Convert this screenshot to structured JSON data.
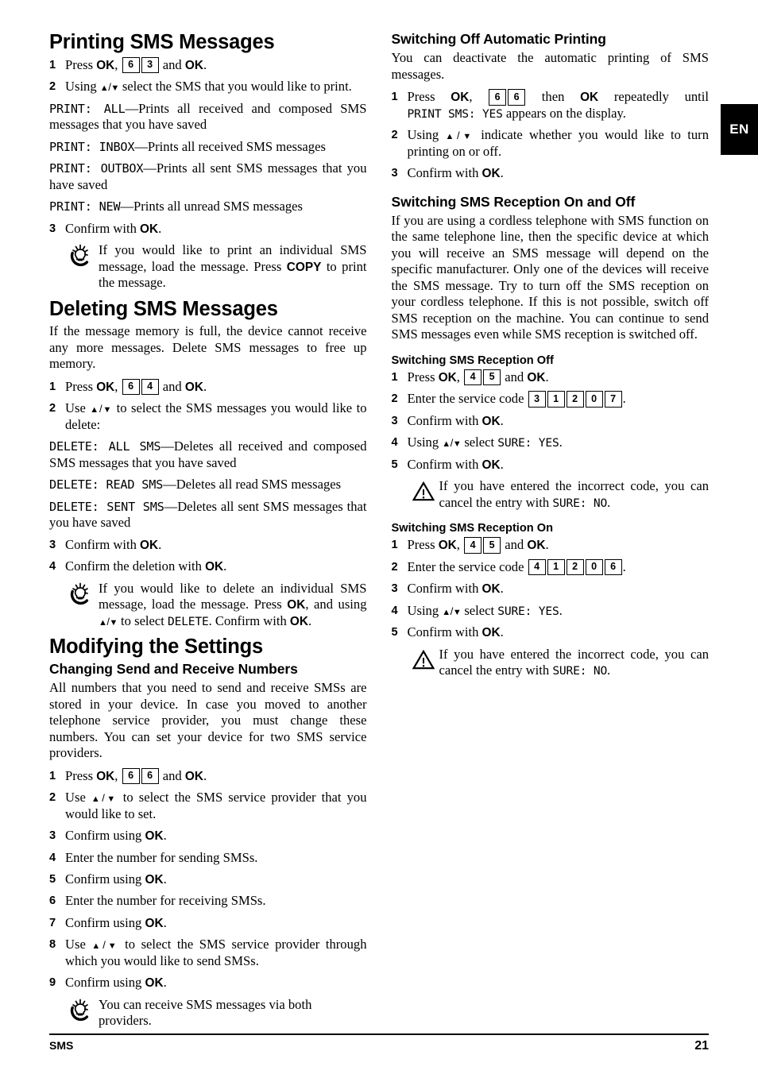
{
  "page": {
    "language_tab": "EN",
    "footer_left": "SMS",
    "footer_page": "21"
  },
  "left_column": {
    "section1": {
      "heading": "Printing SMS Messages",
      "steps": [
        {
          "num": "1",
          "pre": "Press ",
          "key_ok_1": "OK",
          "mid": ", ",
          "keys": [
            "6",
            "3"
          ],
          "post_pre": " and ",
          "key_ok_2": "OK",
          "post": "."
        },
        {
          "num": "2",
          "text_a": "Using ",
          "text_b": " select the SMS that you would like to print."
        }
      ],
      "options": [
        {
          "lcd": "PRINT: ALL",
          "desc": "—Prints all received and composed SMS messages that you have saved"
        },
        {
          "lcd": "PRINT: INBOX",
          "desc": "—Prints all received SMS messages"
        },
        {
          "lcd": "PRINT: OUTBOX",
          "desc": "—Prints all sent SMS messages that you have saved"
        },
        {
          "lcd": "PRINT: NEW",
          "desc": "—Prints all unread SMS messages"
        }
      ],
      "step3": {
        "num": "3",
        "pre": "Confirm with ",
        "key_ok": "OK",
        "post": "."
      },
      "tip": {
        "icon": "tip-hand-icon",
        "text_a": "If you would like to print an individual SMS message, load the message. Press ",
        "key": "COPY",
        "text_b": " to print the message."
      }
    },
    "section2": {
      "heading": "Deleting SMS Messages",
      "intro": "If the message memory is full, the device cannot receive any more messages. Delete SMS messages to free up memory.",
      "steps": [
        {
          "num": "1",
          "pre": "Press ",
          "key_ok_1": "OK",
          "mid": ", ",
          "keys": [
            "6",
            "4"
          ],
          "post_pre": " and ",
          "key_ok_2": "OK",
          "post": "."
        },
        {
          "num": "2",
          "text_a": "Use ",
          "text_b": " to select the SMS messages you would like to delete:"
        }
      ],
      "options": [
        {
          "lcd": "DELETE: ALL SMS",
          "desc": "—Deletes all received and composed SMS messages that you have saved"
        },
        {
          "lcd": "DELETE: READ SMS",
          "desc": "—Deletes all read SMS messages"
        },
        {
          "lcd": "DELETE: SENT SMS",
          "desc": "—Deletes all sent SMS messages that you have saved"
        }
      ],
      "step3": {
        "num": "3",
        "pre": "Confirm with ",
        "key_ok": "OK",
        "post": "."
      },
      "step4": {
        "num": "4",
        "pre": "Confirm the deletion with ",
        "key_ok": "OK",
        "post": "."
      },
      "tip": {
        "icon": "tip-hand-icon",
        "text_a": "If you would like to delete an individual SMS message, load the message. Press ",
        "key1": "OK",
        "text_b": ", and using ",
        "text_c": " to select ",
        "lcd": "DELETE",
        "text_d": ". Confirm with ",
        "key2": "OK",
        "text_e": "."
      }
    },
    "section3": {
      "heading": "Modifying the Settings",
      "subheading": "Changing Send and Receive Numbers",
      "intro": "All numbers that you need to send and receive SMSs are stored in your device. In case you moved to another telephone service provider, you must change these numbers. You can set your device for two SMS service providers.",
      "steps": [
        {
          "num": "1",
          "pre": "Press ",
          "key_ok_1": "OK",
          "mid": ", ",
          "keys": [
            "6",
            "6"
          ],
          "post_pre": " and ",
          "key_ok_2": "OK",
          "post": "."
        },
        {
          "num": "2",
          "text_a": "Use ",
          "text_b": " to select the SMS service provider that you would like to set."
        },
        {
          "num": "3",
          "pre": "Confirm using ",
          "key_ok": "OK",
          "post": "."
        },
        {
          "num": "4",
          "plain": "Enter the number for sending SMSs."
        },
        {
          "num": "5",
          "pre": "Confirm using ",
          "key_ok": "OK",
          "post": "."
        },
        {
          "num": "6",
          "plain": "Enter the number for receiving SMSs."
        },
        {
          "num": "7",
          "pre": "Confirm using ",
          "key_ok": "OK",
          "post": "."
        },
        {
          "num": "8",
          "text_a": "Use ",
          "text_b": " to select the SMS service provider through which you would like to send SMSs."
        },
        {
          "num": "9",
          "pre": "Confirm using ",
          "key_ok": "OK",
          "post": "."
        }
      ],
      "tip": {
        "icon": "tip-hand-icon",
        "text": "You can receive SMS messages via both providers."
      }
    }
  },
  "right_column": {
    "section1": {
      "heading": "Switching Off Automatic Printing",
      "intro": "You can deactivate the automatic printing of SMS messages.",
      "step1": {
        "num": "1",
        "pre": "Press ",
        "key_ok_1": "OK",
        "mid": ", ",
        "keys": [
          "6",
          "6"
        ],
        "post_pre": " then ",
        "key_ok_2": "OK",
        "post_mid": " repeatedly until ",
        "lcd": "PRINT SMS: YES",
        "post": " appears on the display."
      },
      "step2": {
        "num": "2",
        "text_a": "Using ",
        "text_b": " indicate whether you would like to turn printing on or off."
      },
      "step3": {
        "num": "3",
        "pre": "Confirm with ",
        "key_ok": "OK",
        "post": "."
      }
    },
    "section2": {
      "heading": "Switching SMS Reception On and Off",
      "intro": "If you are using a cordless telephone with SMS function on the same telephone line, then the specific device at which you will receive an SMS message will depend on the specific manufacturer. Only one of the devices will receive the SMS message. Try to turn off the SMS reception on your cordless telephone. If this is not possible, switch off SMS reception on the machine. You can continue to send SMS messages even while SMS reception is switched off.",
      "sub_off": {
        "heading": "Switching SMS Reception Off",
        "steps": [
          {
            "num": "1",
            "pre": "Press ",
            "key_ok_1": "OK",
            "mid": ", ",
            "keys": [
              "4",
              "5"
            ],
            "post_pre": " and ",
            "key_ok_2": "OK",
            "post": "."
          },
          {
            "num": "2",
            "pre": "Enter the service code ",
            "keys": [
              "3",
              "1",
              "2",
              "0",
              "7"
            ],
            "post": "."
          },
          {
            "num": "3",
            "pre": "Confirm with ",
            "key_ok": "OK",
            "post": "."
          },
          {
            "num": "4",
            "text_a": "Using ",
            "text_b": " select ",
            "lcd": "SURE: YES",
            "text_c": "."
          },
          {
            "num": "5",
            "pre": "Confirm with ",
            "key_ok": "OK",
            "post": "."
          }
        ],
        "warning": {
          "icon": "warning-triangle-icon",
          "text_a": "If you have entered the incorrect code, you can cancel the entry with ",
          "lcd": "SURE: NO",
          "text_b": "."
        }
      },
      "sub_on": {
        "heading": "Switching SMS Reception On",
        "steps": [
          {
            "num": "1",
            "pre": "Press ",
            "key_ok_1": "OK",
            "mid": ", ",
            "keys": [
              "4",
              "5"
            ],
            "post_pre": " and ",
            "key_ok_2": "OK",
            "post": "."
          },
          {
            "num": "2",
            "pre": "Enter the service code ",
            "keys": [
              "4",
              "1",
              "2",
              "0",
              "6"
            ],
            "post": "."
          },
          {
            "num": "3",
            "pre": "Confirm with ",
            "key_ok": "OK",
            "post": "."
          },
          {
            "num": "4",
            "text_a": "Using ",
            "text_b": " select ",
            "lcd": "SURE: YES",
            "text_c": "."
          },
          {
            "num": "5",
            "pre": "Confirm with ",
            "key_ok": "OK",
            "post": "."
          }
        ],
        "warning": {
          "icon": "warning-triangle-icon",
          "text_a": "If you have entered the incorrect code, you can cancel the entry with ",
          "lcd": "SURE: NO",
          "text_b": "."
        }
      }
    }
  }
}
